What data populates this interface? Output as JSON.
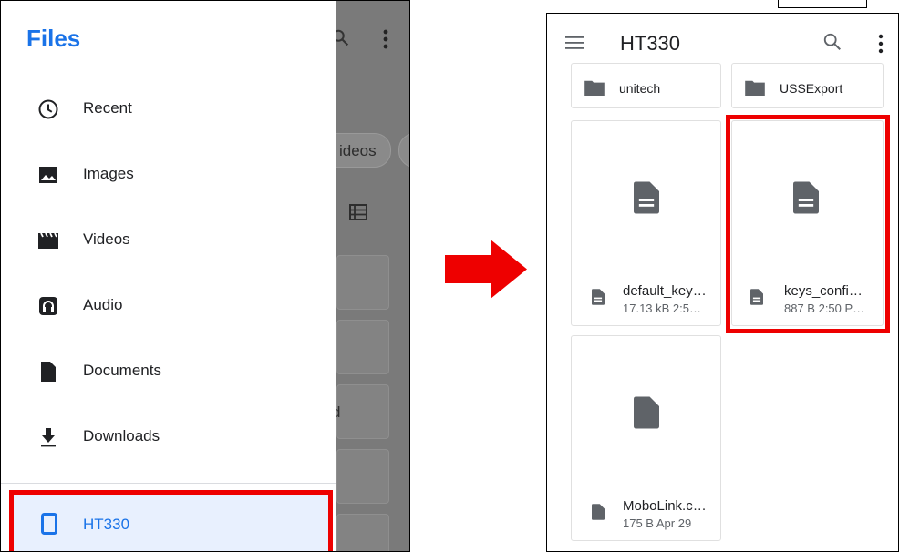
{
  "left_panel": {
    "drawer_title": "Files",
    "nav_items": [
      {
        "label": "Recent",
        "icon": "clock-icon"
      },
      {
        "label": "Images",
        "icon": "image-icon"
      },
      {
        "label": "Videos",
        "icon": "video-icon"
      },
      {
        "label": "Audio",
        "icon": "headphones-icon"
      },
      {
        "label": "Documents",
        "icon": "document-icon"
      },
      {
        "label": "Downloads",
        "icon": "download-icon"
      },
      {
        "label": "HT330",
        "icon": "phone-device-icon"
      }
    ],
    "background": {
      "chip_label": "ideos",
      "partial_text": "d"
    }
  },
  "right_panel": {
    "title": "HT330",
    "folders": [
      {
        "name": "unitech",
        "icon": "folder-icon"
      },
      {
        "name": "USSExport",
        "icon": "folder-icon"
      }
    ],
    "files": [
      {
        "name": "default_key…",
        "meta": "17.13 kB 2:5…",
        "icon": "text-document-icon"
      },
      {
        "name": "keys_confi…",
        "meta": "887 B 2:50 P…",
        "icon": "text-document-icon"
      },
      {
        "name": "MoboLink.c…",
        "meta": "175 B Apr 29",
        "icon": "file-icon"
      }
    ]
  },
  "colors": {
    "accent": "#1a73e8",
    "selected_background": "#e8f0fe",
    "highlight": "#ee0000",
    "scrim": "#7a7a7a"
  }
}
